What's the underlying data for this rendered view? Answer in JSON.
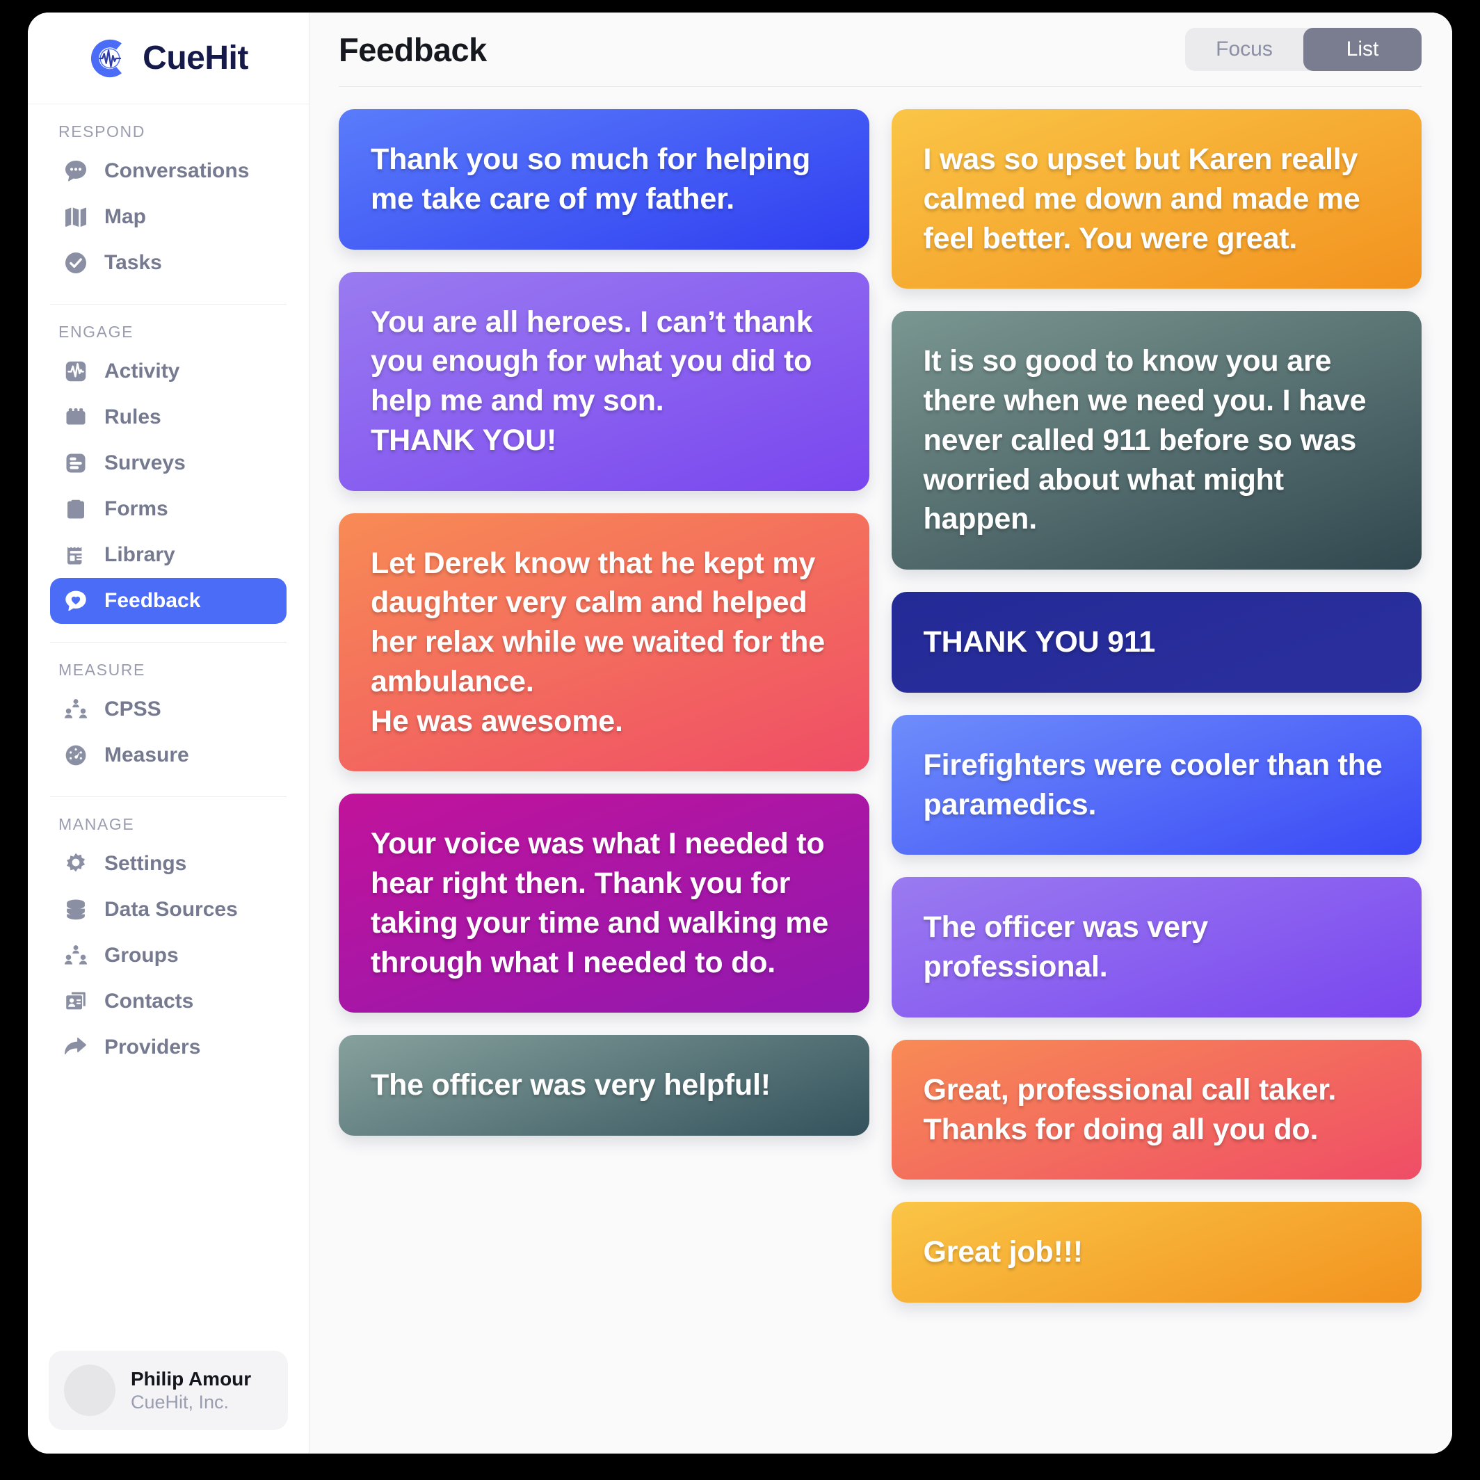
{
  "brand": {
    "name": "CueHit",
    "logo_icon": "cuehit-logo-icon"
  },
  "sidebar": {
    "groups": [
      {
        "label": "RESPOND",
        "items": [
          {
            "label": "Conversations",
            "icon": "chat-bubble-icon",
            "active": false
          },
          {
            "label": "Map",
            "icon": "map-icon",
            "active": false
          },
          {
            "label": "Tasks",
            "icon": "check-circle-icon",
            "active": false
          }
        ]
      },
      {
        "label": "ENGAGE",
        "items": [
          {
            "label": "Activity",
            "icon": "pulse-icon",
            "active": false
          },
          {
            "label": "Rules",
            "icon": "brick-icon",
            "active": false
          },
          {
            "label": "Surveys",
            "icon": "survey-list-icon",
            "active": false
          },
          {
            "label": "Forms",
            "icon": "clipboard-icon",
            "active": false
          },
          {
            "label": "Library",
            "icon": "library-document-icon",
            "active": false
          },
          {
            "label": "Feedback",
            "icon": "heart-bubble-icon",
            "active": true
          }
        ]
      },
      {
        "label": "MEASURE",
        "items": [
          {
            "label": "CPSS",
            "icon": "people-group-icon",
            "active": false
          },
          {
            "label": "Measure",
            "icon": "gauge-icon",
            "active": false
          }
        ]
      },
      {
        "label": "MANAGE",
        "items": [
          {
            "label": "Settings",
            "icon": "gear-icon",
            "active": false
          },
          {
            "label": "Data Sources",
            "icon": "database-icon",
            "active": false
          },
          {
            "label": "Groups",
            "icon": "people-group-icon",
            "active": false
          },
          {
            "label": "Contacts",
            "icon": "contact-card-icon",
            "active": false
          },
          {
            "label": "Providers",
            "icon": "share-arrow-icon",
            "active": false
          }
        ]
      }
    ],
    "user": {
      "name": "Philip Amour",
      "org": "CueHit, Inc.",
      "avatar": "avatar"
    }
  },
  "header": {
    "title": "Feedback",
    "view_toggle": {
      "options": [
        "Focus",
        "List"
      ],
      "selected": "List"
    }
  },
  "colors": {
    "accent": "#4a6cf7",
    "sidebar_text": "#767a90",
    "toggle_active_bg": "#7a7d90",
    "page_bg": "#fafafb"
  },
  "feedback": {
    "columns": [
      [
        {
          "text": "Thank you so much for helping me take care of my father.",
          "gradient_from": "#5a7cfb",
          "gradient_to": "#2f3ef0"
        },
        {
          "text": "You are all heroes. I can’t thank you enough for what you did to help me and my son.\nTHANK YOU!",
          "gradient_from": "#9a7bf0",
          "gradient_to": "#7a46ef"
        },
        {
          "text": "Let Derek know that he kept my daughter very calm and helped her relax while we waited for the ambulance.\nHe was awesome.",
          "gradient_from": "#f88b55",
          "gradient_to": "#ef4d66"
        },
        {
          "text": "Your voice was what I needed to hear right then. Thank you for taking your time and walking me through what I needed to do.",
          "gradient_from": "#c2139b",
          "gradient_to": "#8f19b0"
        },
        {
          "text": "The officer was very helpful!",
          "gradient_from": "#87a19d",
          "gradient_to": "#33525c"
        }
      ],
      [
        {
          "text": "I was so upset but Karen really calmed me down and made me feel better. You were great.",
          "gradient_from": "#fac546",
          "gradient_to": "#f2921f"
        },
        {
          "text": "It is so good to know you are there when we need you. I have never called 911 before so was worried about what might happen.",
          "gradient_from": "#7b9791",
          "gradient_to": "#31474f"
        },
        {
          "text": "THANK YOU 911",
          "gradient_from": "#232a96",
          "gradient_to": "#2b2f9e"
        },
        {
          "text": "Firefighters were cooler than the paramedics.",
          "gradient_from": "#6f8dfb",
          "gradient_to": "#3949f5"
        },
        {
          "text": "The officer was very professional.",
          "gradient_from": "#9a7bf0",
          "gradient_to": "#7a46ef"
        },
        {
          "text": "Great, professional call taker. Thanks for doing all you do.",
          "gradient_from": "#f88b55",
          "gradient_to": "#ef4d66"
        },
        {
          "text": "Great job!!!",
          "gradient_from": "#fac546",
          "gradient_to": "#f2921f"
        }
      ]
    ]
  }
}
